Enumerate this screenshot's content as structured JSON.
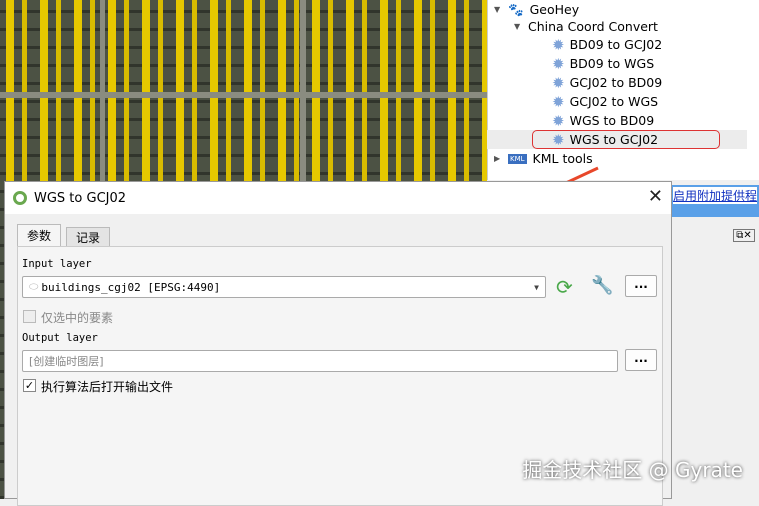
{
  "tree": {
    "geohey": "GeoHey",
    "group": "China Coord Convert",
    "items": [
      "BD09 to GCJ02",
      "BD09 to WGS",
      "GCJ02 to BD09",
      "GCJ02 to WGS",
      "WGS to BD09",
      "WGS to GCJ02"
    ],
    "kml": "KML tools"
  },
  "side": {
    "link": "启用附加提供程"
  },
  "dialog": {
    "title": "WGS to GCJ02",
    "tabs": [
      "参数",
      "记录"
    ],
    "input_label": "Input layer",
    "input_value": "buildings_cgj02 [EPSG:4490]",
    "selected_only": "仅选中的要素",
    "output_label": "Output layer",
    "output_placeholder": "[创建临时图层]",
    "open_after": "执行算法后打开输出文件",
    "more": "..."
  },
  "watermark": "掘金技术社区 @ Gyrate"
}
